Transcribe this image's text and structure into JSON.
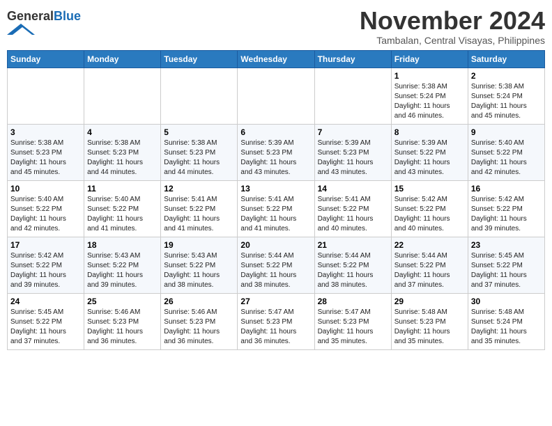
{
  "header": {
    "logo_general": "General",
    "logo_blue": "Blue",
    "month_title": "November 2024",
    "location": "Tambalan, Central Visayas, Philippines"
  },
  "weekdays": [
    "Sunday",
    "Monday",
    "Tuesday",
    "Wednesday",
    "Thursday",
    "Friday",
    "Saturday"
  ],
  "weeks": [
    [
      {
        "day": "",
        "info": ""
      },
      {
        "day": "",
        "info": ""
      },
      {
        "day": "",
        "info": ""
      },
      {
        "day": "",
        "info": ""
      },
      {
        "day": "",
        "info": ""
      },
      {
        "day": "1",
        "info": "Sunrise: 5:38 AM\nSunset: 5:24 PM\nDaylight: 11 hours\nand 46 minutes."
      },
      {
        "day": "2",
        "info": "Sunrise: 5:38 AM\nSunset: 5:24 PM\nDaylight: 11 hours\nand 45 minutes."
      }
    ],
    [
      {
        "day": "3",
        "info": "Sunrise: 5:38 AM\nSunset: 5:23 PM\nDaylight: 11 hours\nand 45 minutes."
      },
      {
        "day": "4",
        "info": "Sunrise: 5:38 AM\nSunset: 5:23 PM\nDaylight: 11 hours\nand 44 minutes."
      },
      {
        "day": "5",
        "info": "Sunrise: 5:38 AM\nSunset: 5:23 PM\nDaylight: 11 hours\nand 44 minutes."
      },
      {
        "day": "6",
        "info": "Sunrise: 5:39 AM\nSunset: 5:23 PM\nDaylight: 11 hours\nand 43 minutes."
      },
      {
        "day": "7",
        "info": "Sunrise: 5:39 AM\nSunset: 5:23 PM\nDaylight: 11 hours\nand 43 minutes."
      },
      {
        "day": "8",
        "info": "Sunrise: 5:39 AM\nSunset: 5:22 PM\nDaylight: 11 hours\nand 43 minutes."
      },
      {
        "day": "9",
        "info": "Sunrise: 5:40 AM\nSunset: 5:22 PM\nDaylight: 11 hours\nand 42 minutes."
      }
    ],
    [
      {
        "day": "10",
        "info": "Sunrise: 5:40 AM\nSunset: 5:22 PM\nDaylight: 11 hours\nand 42 minutes."
      },
      {
        "day": "11",
        "info": "Sunrise: 5:40 AM\nSunset: 5:22 PM\nDaylight: 11 hours\nand 41 minutes."
      },
      {
        "day": "12",
        "info": "Sunrise: 5:41 AM\nSunset: 5:22 PM\nDaylight: 11 hours\nand 41 minutes."
      },
      {
        "day": "13",
        "info": "Sunrise: 5:41 AM\nSunset: 5:22 PM\nDaylight: 11 hours\nand 41 minutes."
      },
      {
        "day": "14",
        "info": "Sunrise: 5:41 AM\nSunset: 5:22 PM\nDaylight: 11 hours\nand 40 minutes."
      },
      {
        "day": "15",
        "info": "Sunrise: 5:42 AM\nSunset: 5:22 PM\nDaylight: 11 hours\nand 40 minutes."
      },
      {
        "day": "16",
        "info": "Sunrise: 5:42 AM\nSunset: 5:22 PM\nDaylight: 11 hours\nand 39 minutes."
      }
    ],
    [
      {
        "day": "17",
        "info": "Sunrise: 5:42 AM\nSunset: 5:22 PM\nDaylight: 11 hours\nand 39 minutes."
      },
      {
        "day": "18",
        "info": "Sunrise: 5:43 AM\nSunset: 5:22 PM\nDaylight: 11 hours\nand 39 minutes."
      },
      {
        "day": "19",
        "info": "Sunrise: 5:43 AM\nSunset: 5:22 PM\nDaylight: 11 hours\nand 38 minutes."
      },
      {
        "day": "20",
        "info": "Sunrise: 5:44 AM\nSunset: 5:22 PM\nDaylight: 11 hours\nand 38 minutes."
      },
      {
        "day": "21",
        "info": "Sunrise: 5:44 AM\nSunset: 5:22 PM\nDaylight: 11 hours\nand 38 minutes."
      },
      {
        "day": "22",
        "info": "Sunrise: 5:44 AM\nSunset: 5:22 PM\nDaylight: 11 hours\nand 37 minutes."
      },
      {
        "day": "23",
        "info": "Sunrise: 5:45 AM\nSunset: 5:22 PM\nDaylight: 11 hours\nand 37 minutes."
      }
    ],
    [
      {
        "day": "24",
        "info": "Sunrise: 5:45 AM\nSunset: 5:22 PM\nDaylight: 11 hours\nand 37 minutes."
      },
      {
        "day": "25",
        "info": "Sunrise: 5:46 AM\nSunset: 5:23 PM\nDaylight: 11 hours\nand 36 minutes."
      },
      {
        "day": "26",
        "info": "Sunrise: 5:46 AM\nSunset: 5:23 PM\nDaylight: 11 hours\nand 36 minutes."
      },
      {
        "day": "27",
        "info": "Sunrise: 5:47 AM\nSunset: 5:23 PM\nDaylight: 11 hours\nand 36 minutes."
      },
      {
        "day": "28",
        "info": "Sunrise: 5:47 AM\nSunset: 5:23 PM\nDaylight: 11 hours\nand 35 minutes."
      },
      {
        "day": "29",
        "info": "Sunrise: 5:48 AM\nSunset: 5:23 PM\nDaylight: 11 hours\nand 35 minutes."
      },
      {
        "day": "30",
        "info": "Sunrise: 5:48 AM\nSunset: 5:24 PM\nDaylight: 11 hours\nand 35 minutes."
      }
    ]
  ]
}
